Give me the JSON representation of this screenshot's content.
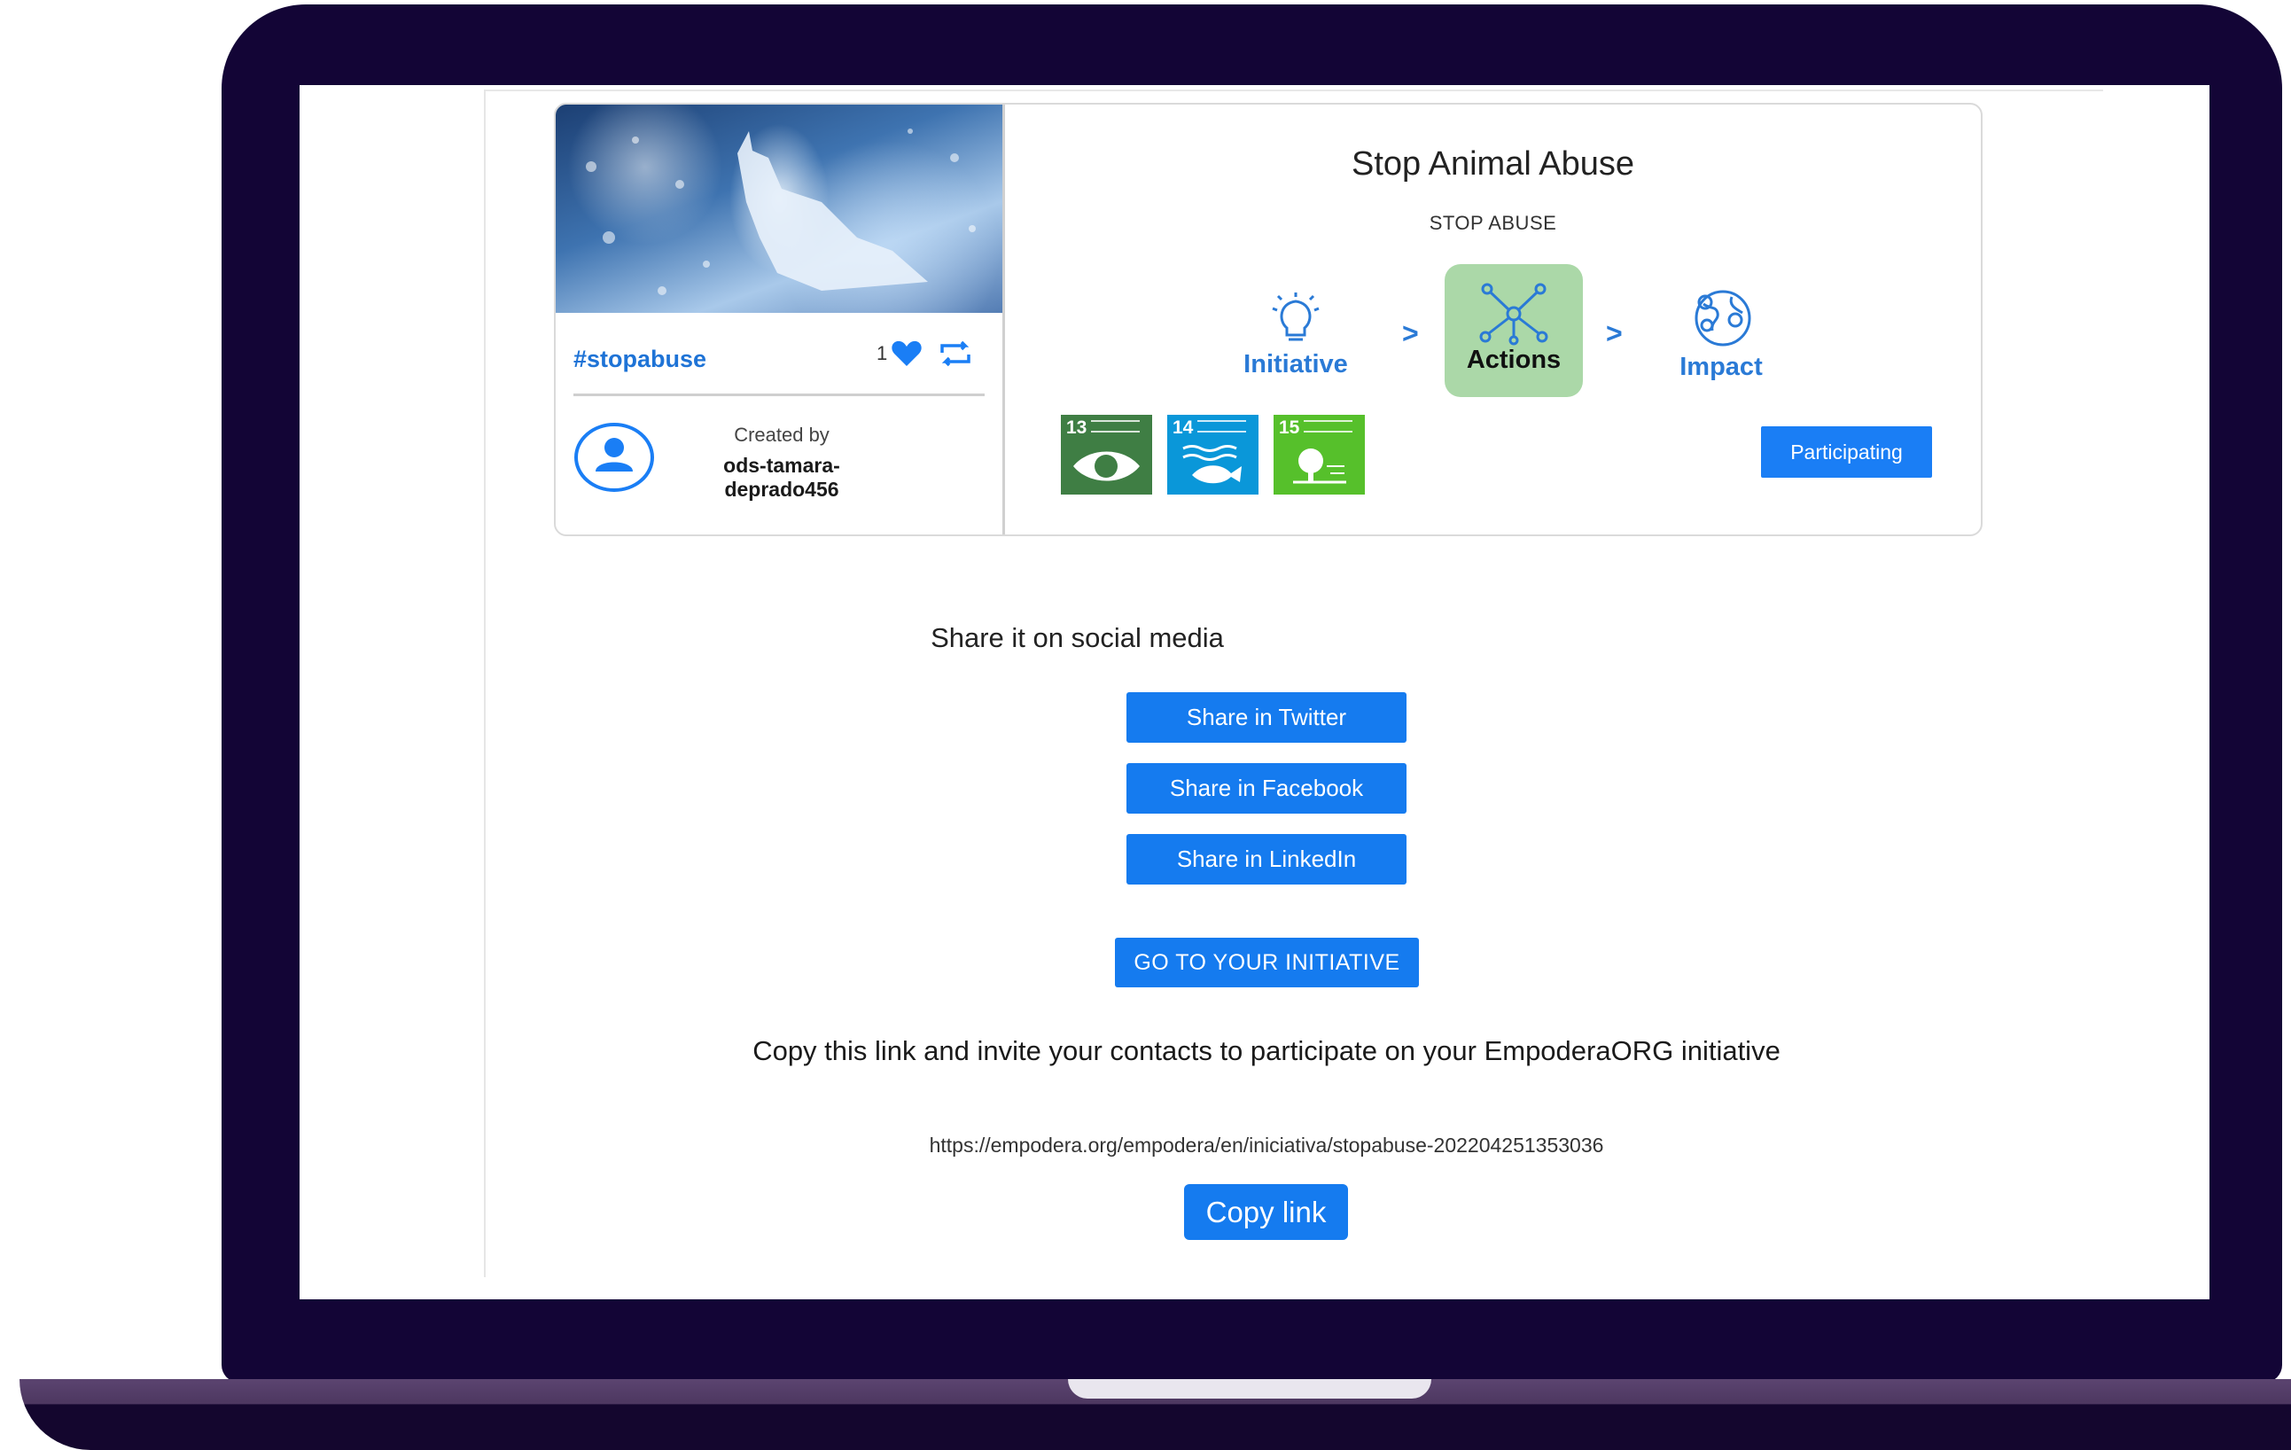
{
  "initiative": {
    "title": "Stop Animal Abuse",
    "subtitle": "STOP ABUSE",
    "hashtag": "#stopabuse",
    "likes": "1",
    "created_by_label": "Created by",
    "creator": "ods-tamara-deprado456",
    "stages": [
      {
        "label": "Initiative",
        "icon": "lightbulb-icon"
      },
      {
        "label": "Actions",
        "icon": "network-icon",
        "active": true
      },
      {
        "label": "Impact",
        "icon": "globe-icon"
      }
    ],
    "stage_separator": ">",
    "sdgs": [
      {
        "number": "13",
        "color": "#3f7e44"
      },
      {
        "number": "14",
        "color": "#0a97d9"
      },
      {
        "number": "15",
        "color": "#56c02b"
      }
    ],
    "participating_label": "Participating"
  },
  "share": {
    "heading": "Share it on social media",
    "twitter": "Share in Twitter",
    "facebook": "Share in Facebook",
    "linkedin": "Share in LinkedIn",
    "go_initiative": "GO TO YOUR INITIATIVE",
    "invite_text": "Copy this link and invite your contacts to participate on your EmpoderaORG initiative",
    "link": "https://empodera.org/empodera/en/iniciativa/stopabuse-202204251353036",
    "copy_label": "Copy link"
  },
  "colors": {
    "accent": "#157bef",
    "stage_active": "#abd8a8",
    "laptop": "#130536"
  }
}
